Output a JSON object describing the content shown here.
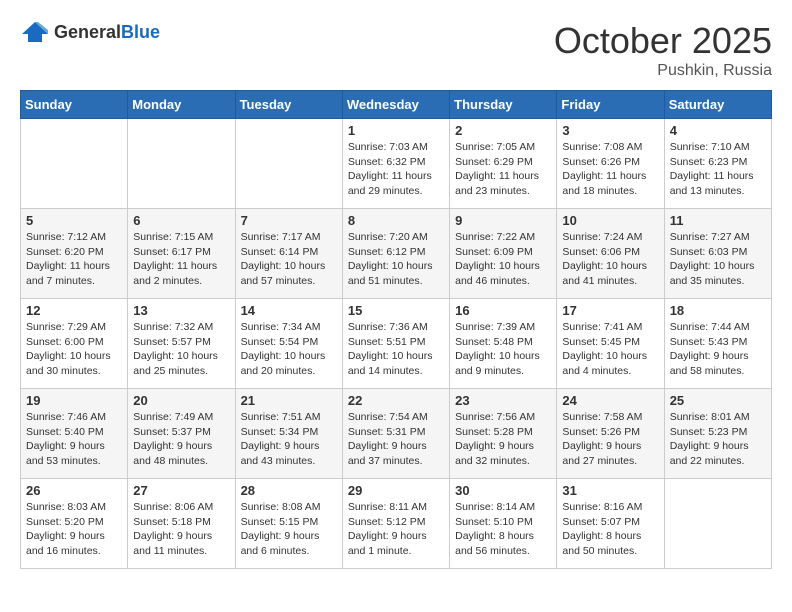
{
  "header": {
    "logo_general": "General",
    "logo_blue": "Blue",
    "month_title": "October 2025",
    "location": "Pushkin, Russia"
  },
  "weekdays": [
    "Sunday",
    "Monday",
    "Tuesday",
    "Wednesday",
    "Thursday",
    "Friday",
    "Saturday"
  ],
  "weeks": [
    [
      {
        "day": "",
        "info": ""
      },
      {
        "day": "",
        "info": ""
      },
      {
        "day": "",
        "info": ""
      },
      {
        "day": "1",
        "info": "Sunrise: 7:03 AM\nSunset: 6:32 PM\nDaylight: 11 hours\nand 29 minutes."
      },
      {
        "day": "2",
        "info": "Sunrise: 7:05 AM\nSunset: 6:29 PM\nDaylight: 11 hours\nand 23 minutes."
      },
      {
        "day": "3",
        "info": "Sunrise: 7:08 AM\nSunset: 6:26 PM\nDaylight: 11 hours\nand 18 minutes."
      },
      {
        "day": "4",
        "info": "Sunrise: 7:10 AM\nSunset: 6:23 PM\nDaylight: 11 hours\nand 13 minutes."
      }
    ],
    [
      {
        "day": "5",
        "info": "Sunrise: 7:12 AM\nSunset: 6:20 PM\nDaylight: 11 hours\nand 7 minutes."
      },
      {
        "day": "6",
        "info": "Sunrise: 7:15 AM\nSunset: 6:17 PM\nDaylight: 11 hours\nand 2 minutes."
      },
      {
        "day": "7",
        "info": "Sunrise: 7:17 AM\nSunset: 6:14 PM\nDaylight: 10 hours\nand 57 minutes."
      },
      {
        "day": "8",
        "info": "Sunrise: 7:20 AM\nSunset: 6:12 PM\nDaylight: 10 hours\nand 51 minutes."
      },
      {
        "day": "9",
        "info": "Sunrise: 7:22 AM\nSunset: 6:09 PM\nDaylight: 10 hours\nand 46 minutes."
      },
      {
        "day": "10",
        "info": "Sunrise: 7:24 AM\nSunset: 6:06 PM\nDaylight: 10 hours\nand 41 minutes."
      },
      {
        "day": "11",
        "info": "Sunrise: 7:27 AM\nSunset: 6:03 PM\nDaylight: 10 hours\nand 35 minutes."
      }
    ],
    [
      {
        "day": "12",
        "info": "Sunrise: 7:29 AM\nSunset: 6:00 PM\nDaylight: 10 hours\nand 30 minutes."
      },
      {
        "day": "13",
        "info": "Sunrise: 7:32 AM\nSunset: 5:57 PM\nDaylight: 10 hours\nand 25 minutes."
      },
      {
        "day": "14",
        "info": "Sunrise: 7:34 AM\nSunset: 5:54 PM\nDaylight: 10 hours\nand 20 minutes."
      },
      {
        "day": "15",
        "info": "Sunrise: 7:36 AM\nSunset: 5:51 PM\nDaylight: 10 hours\nand 14 minutes."
      },
      {
        "day": "16",
        "info": "Sunrise: 7:39 AM\nSunset: 5:48 PM\nDaylight: 10 hours\nand 9 minutes."
      },
      {
        "day": "17",
        "info": "Sunrise: 7:41 AM\nSunset: 5:45 PM\nDaylight: 10 hours\nand 4 minutes."
      },
      {
        "day": "18",
        "info": "Sunrise: 7:44 AM\nSunset: 5:43 PM\nDaylight: 9 hours\nand 58 minutes."
      }
    ],
    [
      {
        "day": "19",
        "info": "Sunrise: 7:46 AM\nSunset: 5:40 PM\nDaylight: 9 hours\nand 53 minutes."
      },
      {
        "day": "20",
        "info": "Sunrise: 7:49 AM\nSunset: 5:37 PM\nDaylight: 9 hours\nand 48 minutes."
      },
      {
        "day": "21",
        "info": "Sunrise: 7:51 AM\nSunset: 5:34 PM\nDaylight: 9 hours\nand 43 minutes."
      },
      {
        "day": "22",
        "info": "Sunrise: 7:54 AM\nSunset: 5:31 PM\nDaylight: 9 hours\nand 37 minutes."
      },
      {
        "day": "23",
        "info": "Sunrise: 7:56 AM\nSunset: 5:28 PM\nDaylight: 9 hours\nand 32 minutes."
      },
      {
        "day": "24",
        "info": "Sunrise: 7:58 AM\nSunset: 5:26 PM\nDaylight: 9 hours\nand 27 minutes."
      },
      {
        "day": "25",
        "info": "Sunrise: 8:01 AM\nSunset: 5:23 PM\nDaylight: 9 hours\nand 22 minutes."
      }
    ],
    [
      {
        "day": "26",
        "info": "Sunrise: 8:03 AM\nSunset: 5:20 PM\nDaylight: 9 hours\nand 16 minutes."
      },
      {
        "day": "27",
        "info": "Sunrise: 8:06 AM\nSunset: 5:18 PM\nDaylight: 9 hours\nand 11 minutes."
      },
      {
        "day": "28",
        "info": "Sunrise: 8:08 AM\nSunset: 5:15 PM\nDaylight: 9 hours\nand 6 minutes."
      },
      {
        "day": "29",
        "info": "Sunrise: 8:11 AM\nSunset: 5:12 PM\nDaylight: 9 hours\nand 1 minute."
      },
      {
        "day": "30",
        "info": "Sunrise: 8:14 AM\nSunset: 5:10 PM\nDaylight: 8 hours\nand 56 minutes."
      },
      {
        "day": "31",
        "info": "Sunrise: 8:16 AM\nSunset: 5:07 PM\nDaylight: 8 hours\nand 50 minutes."
      },
      {
        "day": "",
        "info": ""
      }
    ]
  ]
}
